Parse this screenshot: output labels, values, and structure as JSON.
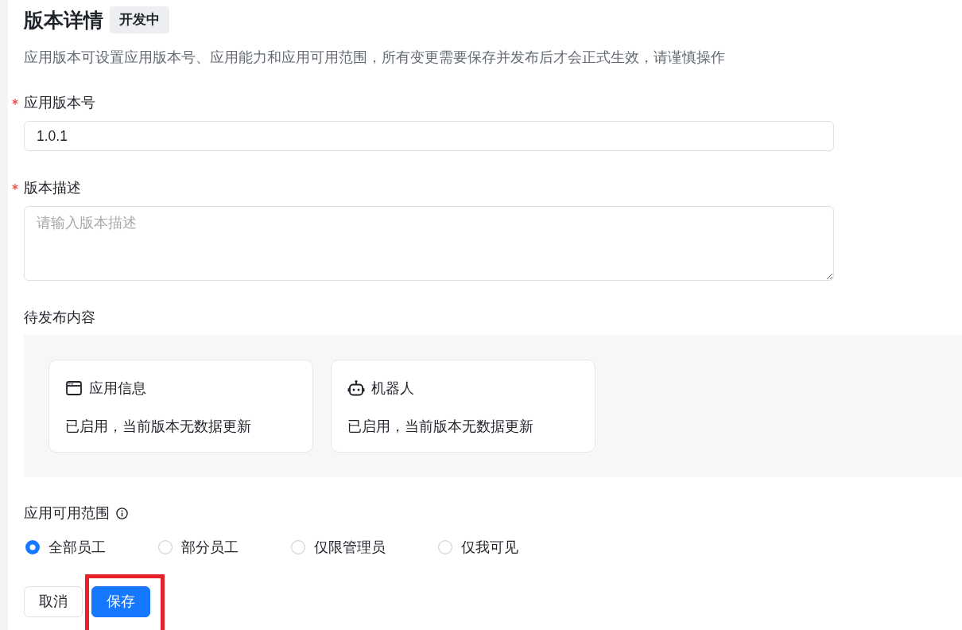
{
  "page": {
    "title": "版本详情",
    "status_badge": "开发中",
    "description": "应用版本可设置应用版本号、应用能力和应用可用范围，所有变更需要保存并发布后才会正式生效，请谨慎操作"
  },
  "fields": [
    {
      "kind": "input",
      "label": "应用版本号",
      "required": true,
      "value": "1.0.1"
    },
    {
      "kind": "textarea",
      "label": "版本描述",
      "required": true,
      "placeholder": "请输入版本描述"
    }
  ],
  "pending": {
    "label": "待发布内容",
    "cards": [
      {
        "kind": "app-info",
        "title": "应用信息",
        "status": "已启用，当前版本无数据更新"
      },
      {
        "kind": "bot",
        "title": "机器人",
        "status": "已启用，当前版本无数据更新"
      }
    ]
  },
  "scope": {
    "label": "应用可用范围",
    "options": [
      {
        "label": "全部员工",
        "selected": true
      },
      {
        "label": "部分员工",
        "selected": false
      },
      {
        "label": "仅限管理员",
        "selected": false
      },
      {
        "label": "仅我可见",
        "selected": false
      }
    ]
  },
  "buttons": [
    {
      "kind": "default",
      "label": "取消",
      "highlighted": false
    },
    {
      "kind": "primary",
      "label": "保存",
      "highlighted": true
    }
  ]
}
